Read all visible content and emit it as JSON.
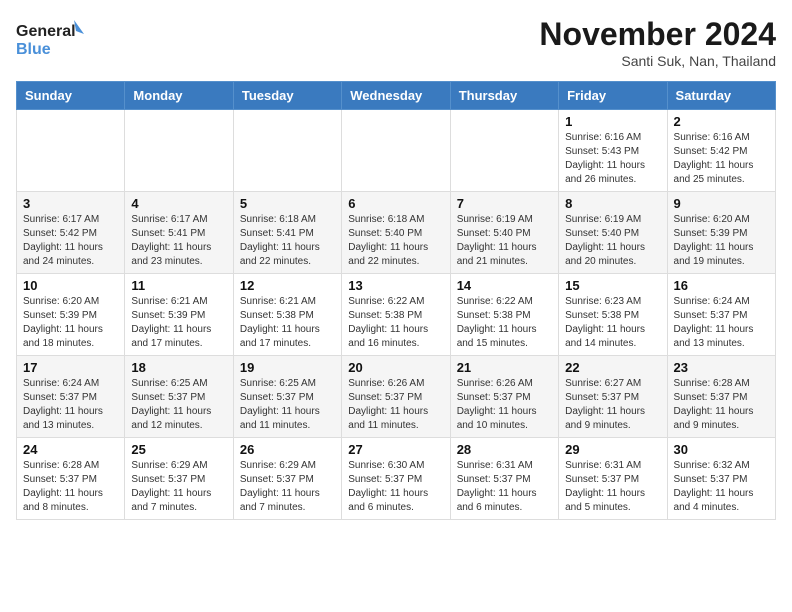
{
  "logo": {
    "line1": "General",
    "line2": "Blue"
  },
  "title": "November 2024",
  "subtitle": "Santi Suk, Nan, Thailand",
  "weekdays": [
    "Sunday",
    "Monday",
    "Tuesday",
    "Wednesday",
    "Thursday",
    "Friday",
    "Saturday"
  ],
  "weeks": [
    [
      {
        "day": "",
        "info": ""
      },
      {
        "day": "",
        "info": ""
      },
      {
        "day": "",
        "info": ""
      },
      {
        "day": "",
        "info": ""
      },
      {
        "day": "",
        "info": ""
      },
      {
        "day": "1",
        "info": "Sunrise: 6:16 AM\nSunset: 5:43 PM\nDaylight: 11 hours and 26 minutes."
      },
      {
        "day": "2",
        "info": "Sunrise: 6:16 AM\nSunset: 5:42 PM\nDaylight: 11 hours and 25 minutes."
      }
    ],
    [
      {
        "day": "3",
        "info": "Sunrise: 6:17 AM\nSunset: 5:42 PM\nDaylight: 11 hours and 24 minutes."
      },
      {
        "day": "4",
        "info": "Sunrise: 6:17 AM\nSunset: 5:41 PM\nDaylight: 11 hours and 23 minutes."
      },
      {
        "day": "5",
        "info": "Sunrise: 6:18 AM\nSunset: 5:41 PM\nDaylight: 11 hours and 22 minutes."
      },
      {
        "day": "6",
        "info": "Sunrise: 6:18 AM\nSunset: 5:40 PM\nDaylight: 11 hours and 22 minutes."
      },
      {
        "day": "7",
        "info": "Sunrise: 6:19 AM\nSunset: 5:40 PM\nDaylight: 11 hours and 21 minutes."
      },
      {
        "day": "8",
        "info": "Sunrise: 6:19 AM\nSunset: 5:40 PM\nDaylight: 11 hours and 20 minutes."
      },
      {
        "day": "9",
        "info": "Sunrise: 6:20 AM\nSunset: 5:39 PM\nDaylight: 11 hours and 19 minutes."
      }
    ],
    [
      {
        "day": "10",
        "info": "Sunrise: 6:20 AM\nSunset: 5:39 PM\nDaylight: 11 hours and 18 minutes."
      },
      {
        "day": "11",
        "info": "Sunrise: 6:21 AM\nSunset: 5:39 PM\nDaylight: 11 hours and 17 minutes."
      },
      {
        "day": "12",
        "info": "Sunrise: 6:21 AM\nSunset: 5:38 PM\nDaylight: 11 hours and 17 minutes."
      },
      {
        "day": "13",
        "info": "Sunrise: 6:22 AM\nSunset: 5:38 PM\nDaylight: 11 hours and 16 minutes."
      },
      {
        "day": "14",
        "info": "Sunrise: 6:22 AM\nSunset: 5:38 PM\nDaylight: 11 hours and 15 minutes."
      },
      {
        "day": "15",
        "info": "Sunrise: 6:23 AM\nSunset: 5:38 PM\nDaylight: 11 hours and 14 minutes."
      },
      {
        "day": "16",
        "info": "Sunrise: 6:24 AM\nSunset: 5:37 PM\nDaylight: 11 hours and 13 minutes."
      }
    ],
    [
      {
        "day": "17",
        "info": "Sunrise: 6:24 AM\nSunset: 5:37 PM\nDaylight: 11 hours and 13 minutes."
      },
      {
        "day": "18",
        "info": "Sunrise: 6:25 AM\nSunset: 5:37 PM\nDaylight: 11 hours and 12 minutes."
      },
      {
        "day": "19",
        "info": "Sunrise: 6:25 AM\nSunset: 5:37 PM\nDaylight: 11 hours and 11 minutes."
      },
      {
        "day": "20",
        "info": "Sunrise: 6:26 AM\nSunset: 5:37 PM\nDaylight: 11 hours and 11 minutes."
      },
      {
        "day": "21",
        "info": "Sunrise: 6:26 AM\nSunset: 5:37 PM\nDaylight: 11 hours and 10 minutes."
      },
      {
        "day": "22",
        "info": "Sunrise: 6:27 AM\nSunset: 5:37 PM\nDaylight: 11 hours and 9 minutes."
      },
      {
        "day": "23",
        "info": "Sunrise: 6:28 AM\nSunset: 5:37 PM\nDaylight: 11 hours and 9 minutes."
      }
    ],
    [
      {
        "day": "24",
        "info": "Sunrise: 6:28 AM\nSunset: 5:37 PM\nDaylight: 11 hours and 8 minutes."
      },
      {
        "day": "25",
        "info": "Sunrise: 6:29 AM\nSunset: 5:37 PM\nDaylight: 11 hours and 7 minutes."
      },
      {
        "day": "26",
        "info": "Sunrise: 6:29 AM\nSunset: 5:37 PM\nDaylight: 11 hours and 7 minutes."
      },
      {
        "day": "27",
        "info": "Sunrise: 6:30 AM\nSunset: 5:37 PM\nDaylight: 11 hours and 6 minutes."
      },
      {
        "day": "28",
        "info": "Sunrise: 6:31 AM\nSunset: 5:37 PM\nDaylight: 11 hours and 6 minutes."
      },
      {
        "day": "29",
        "info": "Sunrise: 6:31 AM\nSunset: 5:37 PM\nDaylight: 11 hours and 5 minutes."
      },
      {
        "day": "30",
        "info": "Sunrise: 6:32 AM\nSunset: 5:37 PM\nDaylight: 11 hours and 4 minutes."
      }
    ]
  ]
}
